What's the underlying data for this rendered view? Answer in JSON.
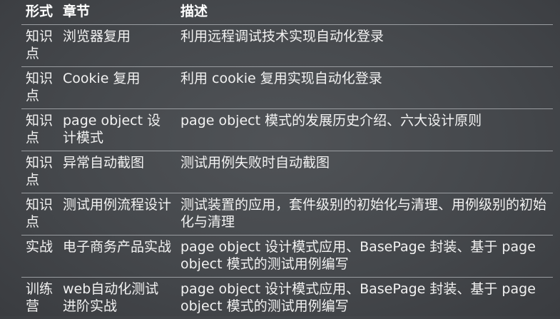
{
  "table": {
    "headers": {
      "form": "形式",
      "chapter": "章节",
      "description": "描述"
    },
    "rows": [
      {
        "form": "知识点",
        "chapter": "浏览器复用",
        "description": "利用远程调试技术实现自动化登录"
      },
      {
        "form": "知识点",
        "chapter": "Cookie 复用",
        "description": "利用 cookie 复用实现自动化登录"
      },
      {
        "form": "知识点",
        "chapter": "page object 设计模式",
        "description": "page object 模式的发展历史介绍、六大设计原则"
      },
      {
        "form": "知识点",
        "chapter": "异常自动截图",
        "description": "测试用例失败时自动截图"
      },
      {
        "form": "知识点",
        "chapter": "测试用例流程设计",
        "description": "测试装置的应用，套件级别的初始化与清理、用例级别的初始化与清理"
      },
      {
        "form": "实战",
        "chapter": "电子商务产品实战",
        "description": "page object 设计模式应用、BasePage 封装、基于 page object 模式的测试用例编写"
      },
      {
        "form": "训练营",
        "chapter": "web自动化测试进阶实战",
        "description": "page object 设计模式应用、BasePage 封装、基于 page object 模式的测试用例编写"
      }
    ]
  }
}
